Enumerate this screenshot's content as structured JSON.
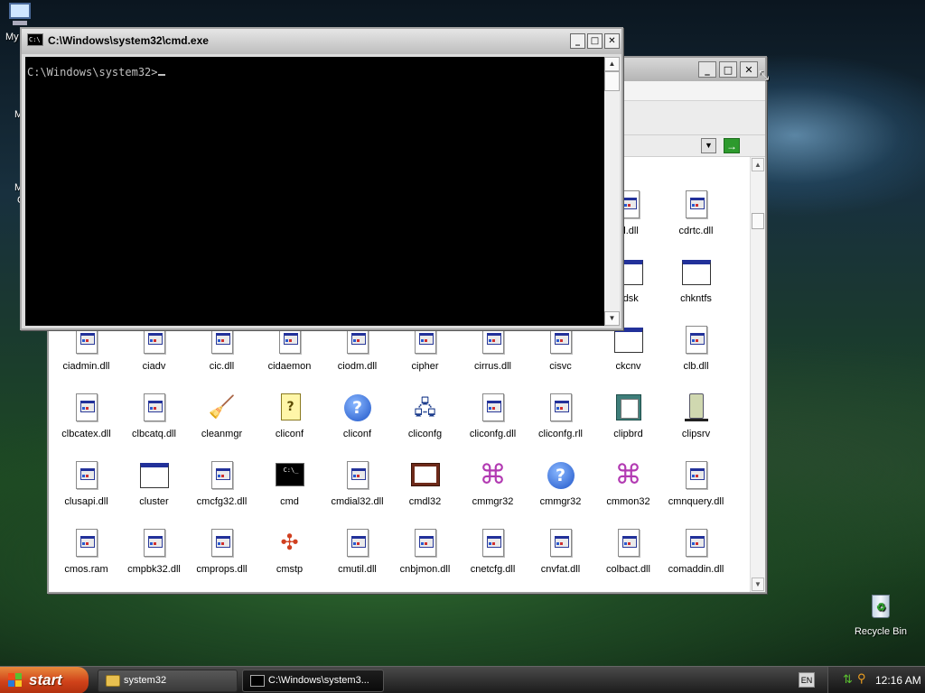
{
  "desktop": {
    "icons": [
      {
        "label": "My",
        "icon": "my-computer-icon"
      },
      {
        "label": "Recycle Bin",
        "icon": "recycle-bin-icon"
      }
    ],
    "fragments": [
      "M",
      "M",
      "C"
    ]
  },
  "cmd_window": {
    "title": "C:\\Windows\\system32\\cmd.exe",
    "prompt": "C:\\Windows\\system32>",
    "buttons": {
      "minimize": "_",
      "maximize": "□",
      "close": "✕"
    }
  },
  "explorer_window": {
    "buttons": {
      "minimize": "_",
      "maximize": "□",
      "close": "✕"
    },
    "address_go": "→",
    "files": [
      {
        "name": "al.dll",
        "icon": "dll"
      },
      {
        "name": "cdrtc.dll",
        "icon": "dll"
      },
      {
        "name": "kdsk",
        "icon": "app"
      },
      {
        "name": "chkntfs",
        "icon": "app"
      },
      {
        "name": "ciadmin.dll",
        "icon": "dll"
      },
      {
        "name": "ciadv",
        "icon": "dll"
      },
      {
        "name": "cic.dll",
        "icon": "dll"
      },
      {
        "name": "cidaemon",
        "icon": "dll"
      },
      {
        "name": "ciodm.dll",
        "icon": "dll"
      },
      {
        "name": "cipher",
        "icon": "dll"
      },
      {
        "name": "cirrus.dll",
        "icon": "dll"
      },
      {
        "name": "cisvc",
        "icon": "dll"
      },
      {
        "name": "ckcnv",
        "icon": "app"
      },
      {
        "name": "clb.dll",
        "icon": "dll"
      },
      {
        "name": "clbcatex.dll",
        "icon": "dll"
      },
      {
        "name": "clbcatq.dll",
        "icon": "dll"
      },
      {
        "name": "cleanmgr",
        "icon": "broom"
      },
      {
        "name": "cliconf",
        "icon": "page-q"
      },
      {
        "name": "cliconf",
        "icon": "help"
      },
      {
        "name": "cliconfg",
        "icon": "net"
      },
      {
        "name": "cliconfg.dll",
        "icon": "dll"
      },
      {
        "name": "cliconfg.rll",
        "icon": "dll"
      },
      {
        "name": "clipbrd",
        "icon": "clip"
      },
      {
        "name": "clipsrv",
        "icon": "clipsrv"
      },
      {
        "name": "clusapi.dll",
        "icon": "dll"
      },
      {
        "name": "cluster",
        "icon": "app"
      },
      {
        "name": "cmcfg32.dll",
        "icon": "dll"
      },
      {
        "name": "cmd",
        "icon": "cmd"
      },
      {
        "name": "cmdial32.dll",
        "icon": "dll"
      },
      {
        "name": "cmdl32",
        "icon": "book"
      },
      {
        "name": "cmmgr32",
        "icon": "mgr"
      },
      {
        "name": "cmmgr32",
        "icon": "help"
      },
      {
        "name": "cmmon32",
        "icon": "mgr"
      },
      {
        "name": "cmnquery.dll",
        "icon": "dll"
      },
      {
        "name": "cmos.ram",
        "icon": "dll"
      },
      {
        "name": "cmpbk32.dll",
        "icon": "dll"
      },
      {
        "name": "cmprops.dll",
        "icon": "dll"
      },
      {
        "name": "cmstp",
        "icon": "cmstp"
      },
      {
        "name": "cmutil.dll",
        "icon": "dll"
      },
      {
        "name": "cnbjmon.dll",
        "icon": "dll"
      },
      {
        "name": "cnetcfg.dll",
        "icon": "dll"
      },
      {
        "name": "cnvfat.dll",
        "icon": "dll"
      },
      {
        "name": "colbact.dll",
        "icon": "dll"
      },
      {
        "name": "comaddin.dll",
        "icon": "dll"
      }
    ]
  },
  "taskbar": {
    "start_label": "start",
    "tasks": [
      {
        "label": "system32",
        "icon": "folder-icon"
      },
      {
        "label": "C:\\Windows\\system3...",
        "icon": "cmd-icon"
      }
    ],
    "language": "EN",
    "clock": "12:16 AM"
  },
  "colors": {
    "start_button": "#d0421a",
    "console_bg": "#000000",
    "console_text": "#c0c0c0"
  }
}
